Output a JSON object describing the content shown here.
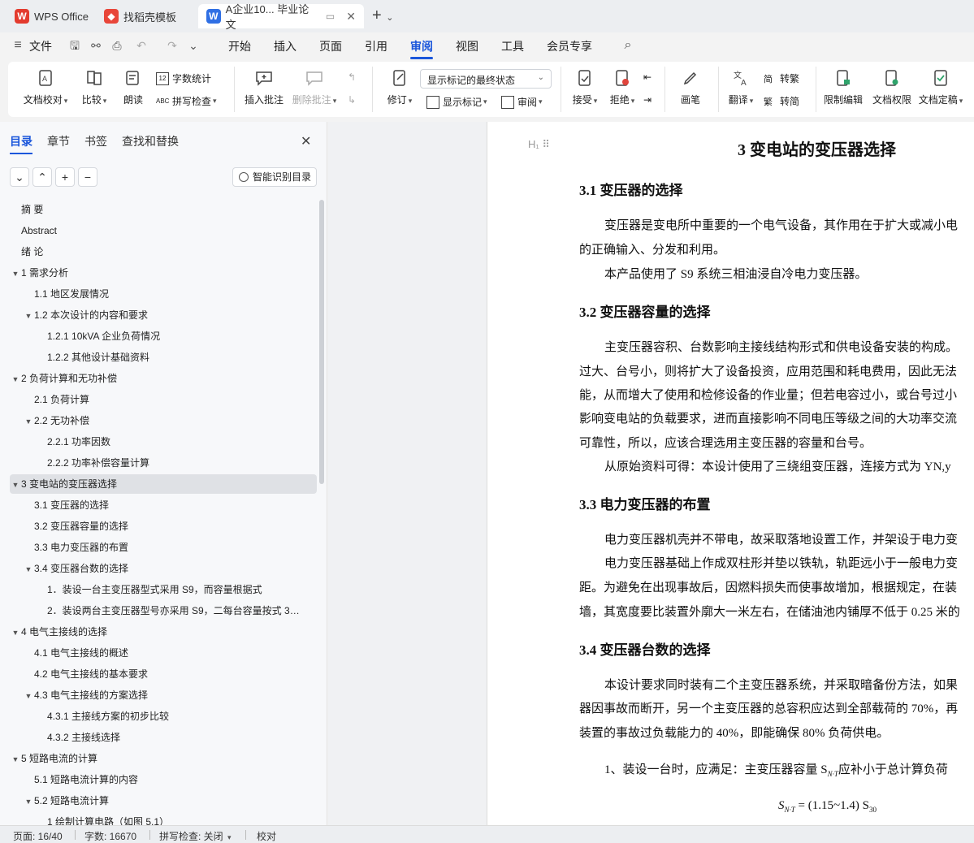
{
  "tabs": [
    {
      "label": "WPS Office",
      "icon": "wps-logo-icon"
    },
    {
      "label": "找稻壳模板",
      "icon": "docer-icon"
    },
    {
      "label": "A企业10... 毕业论文",
      "icon": "writer-icon"
    }
  ],
  "menu": {
    "file": "文件",
    "items": [
      "开始",
      "插入",
      "页面",
      "引用",
      "审阅",
      "视图",
      "工具",
      "会员专享"
    ],
    "active": "审阅"
  },
  "ribbon": {
    "doc_check": "文档校对",
    "compare": "比较",
    "read_aloud": "朗读",
    "word_count": "字数统计",
    "spell_check": "拼写检查",
    "insert_comment": "插入批注",
    "delete_comment": "删除批注",
    "revise": "修订",
    "markup_select": "显示标记的最终状态",
    "show_markup": "显示标记",
    "review_pane": "审阅",
    "accept": "接受",
    "reject": "拒绝",
    "pen": "画笔",
    "translate": "翻译",
    "to_traditional": "转繁",
    "to_simplified": "转简",
    "restrict_edit": "限制编辑",
    "doc_permission": "文档权限",
    "doc_finalize": "文档定稿"
  },
  "nav": {
    "tabs": [
      "目录",
      "章节",
      "书签",
      "查找和替换"
    ],
    "smart_toc": "智能识别目录",
    "toc": [
      {
        "label": "摘 要",
        "level": 0,
        "arrow": ""
      },
      {
        "label": "Abstract",
        "level": 0,
        "arrow": ""
      },
      {
        "label": "绪 论",
        "level": 0,
        "arrow": ""
      },
      {
        "label": "1 需求分析",
        "level": 0,
        "arrow": "▼"
      },
      {
        "label": "1.1 地区发展情况",
        "level": 1,
        "arrow": ""
      },
      {
        "label": "1.2 本次设计的内容和要求",
        "level": 1,
        "arrow": "▼"
      },
      {
        "label": "1.2.1 10kVA 企业负荷情况",
        "level": 2,
        "arrow": ""
      },
      {
        "label": "1.2.2 其他设计基础资料",
        "level": 2,
        "arrow": ""
      },
      {
        "label": "2 负荷计算和无功补偿",
        "level": 0,
        "arrow": "▼"
      },
      {
        "label": "2.1 负荷计算",
        "level": 1,
        "arrow": ""
      },
      {
        "label": "2.2 无功补偿",
        "level": 1,
        "arrow": "▼"
      },
      {
        "label": "2.2.1 功率因数",
        "level": 2,
        "arrow": ""
      },
      {
        "label": "2.2.2 功率补偿容量计算",
        "level": 2,
        "arrow": ""
      },
      {
        "label": "3 变电站的变压器选择",
        "level": 0,
        "arrow": "▼",
        "selected": true
      },
      {
        "label": "3.1 变压器的选择",
        "level": 1,
        "arrow": ""
      },
      {
        "label": "3.2 变压器容量的选择",
        "level": 1,
        "arrow": ""
      },
      {
        "label": "3.3 电力变压器的布置",
        "level": 1,
        "arrow": ""
      },
      {
        "label": "3.4 变压器台数的选择",
        "level": 1,
        "arrow": "▼"
      },
      {
        "label": "1．装设一台主变压器型式采用 S9，而容量根据式",
        "level": 2,
        "arrow": ""
      },
      {
        "label": "2．装设两台主变压器型号亦采用 S9，二每台容量按式 3…",
        "level": 2,
        "arrow": ""
      },
      {
        "label": "4 电气主接线的选择",
        "level": 0,
        "arrow": "▼"
      },
      {
        "label": "4.1 电气主接线的概述",
        "level": 1,
        "arrow": ""
      },
      {
        "label": "4.2 电气主接线的基本要求",
        "level": 1,
        "arrow": ""
      },
      {
        "label": "4.3 电气主接线的方案选择",
        "level": 1,
        "arrow": "▼"
      },
      {
        "label": "4.3.1 主接线方案的初步比较",
        "level": 2,
        "arrow": ""
      },
      {
        "label": "4.3.2 主接线选择",
        "level": 2,
        "arrow": ""
      },
      {
        "label": "5 短路电流的计算",
        "level": 0,
        "arrow": "▼"
      },
      {
        "label": "5.1 短路电流计算的内容",
        "level": 1,
        "arrow": ""
      },
      {
        "label": "5.2 短路电流计算",
        "level": 1,
        "arrow": "▼"
      },
      {
        "label": "1 绘制计算电路（如图 5.1）",
        "level": 2,
        "arrow": ""
      }
    ]
  },
  "doc": {
    "title": "3  变电站的变压器选择",
    "s31": "3.1  变压器的选择",
    "p31a": "变压器是变电所中重要的一个电气设备，其作用在于扩大或减小电",
    "p31b": "的正确输入、分发和利用。",
    "p31c": "本产品使用了 S9 系统三相油浸自冷电力变压器。",
    "s32": "3.2  变压器容量的选择",
    "p32a": "主变压器容积、台数影响主接线结构形式和供电设备安装的构成。",
    "p32b": "过大、台号小，则将扩大了设备投资，应用范围和耗电费用，因此无法",
    "p32c": "能，从而增大了使用和检修设备的作业量；但若电容过小，或台号过小",
    "p32d": "影响变电站的负载要求，进而直接影响不同电压等级之间的大功率交流",
    "p32e": "可靠性，所以，应该合理选用主变压器的容量和台号。",
    "p32f": "从原始资料可得：本设计使用了三绕组变压器，连接方式为 YN,y",
    "s33": "3.3  电力变压器的布置",
    "p33a": "电力变压器机壳并不带电，故采取落地设置工作，并架设于电力变",
    "p33b": "电力变压器基础上作成双柱形并垫以铁轨，轨距远小于一般电力变",
    "p33c": "距。为避免在出现事故后，因燃料损失而使事故增加，根据规定，在装",
    "p33d": "墙，其宽度要比装置外廓大一米左右，在储油池内铺厚不低于 0.25 米的",
    "s34": "3.4  变压器台数的选择",
    "p34a": "本设计要求同时装有二个主变压器系统，并采取暗备份方法，如果",
    "p34b": "器因事故而断开，另一个主变压器的总容积应达到全部载荷的 70%，再",
    "p34c": "装置的事故过负载能力的 40%，即能确保 80% 负荷供电。",
    "p34d": "1、装设一台时，应满足：主变压器容量 S",
    "p34d_sub": "N·T",
    "p34d_tail": "应补小于总计算负荷",
    "formula": "S",
    "formula_sub": "N·T",
    "formula_mid": " = (1.15~1.4) S",
    "formula_sub2": "30"
  },
  "status": {
    "page": "页面: 16/40",
    "words": "字数: 16670",
    "spell": "拼写检查: 关闭",
    "proof": "校对"
  }
}
